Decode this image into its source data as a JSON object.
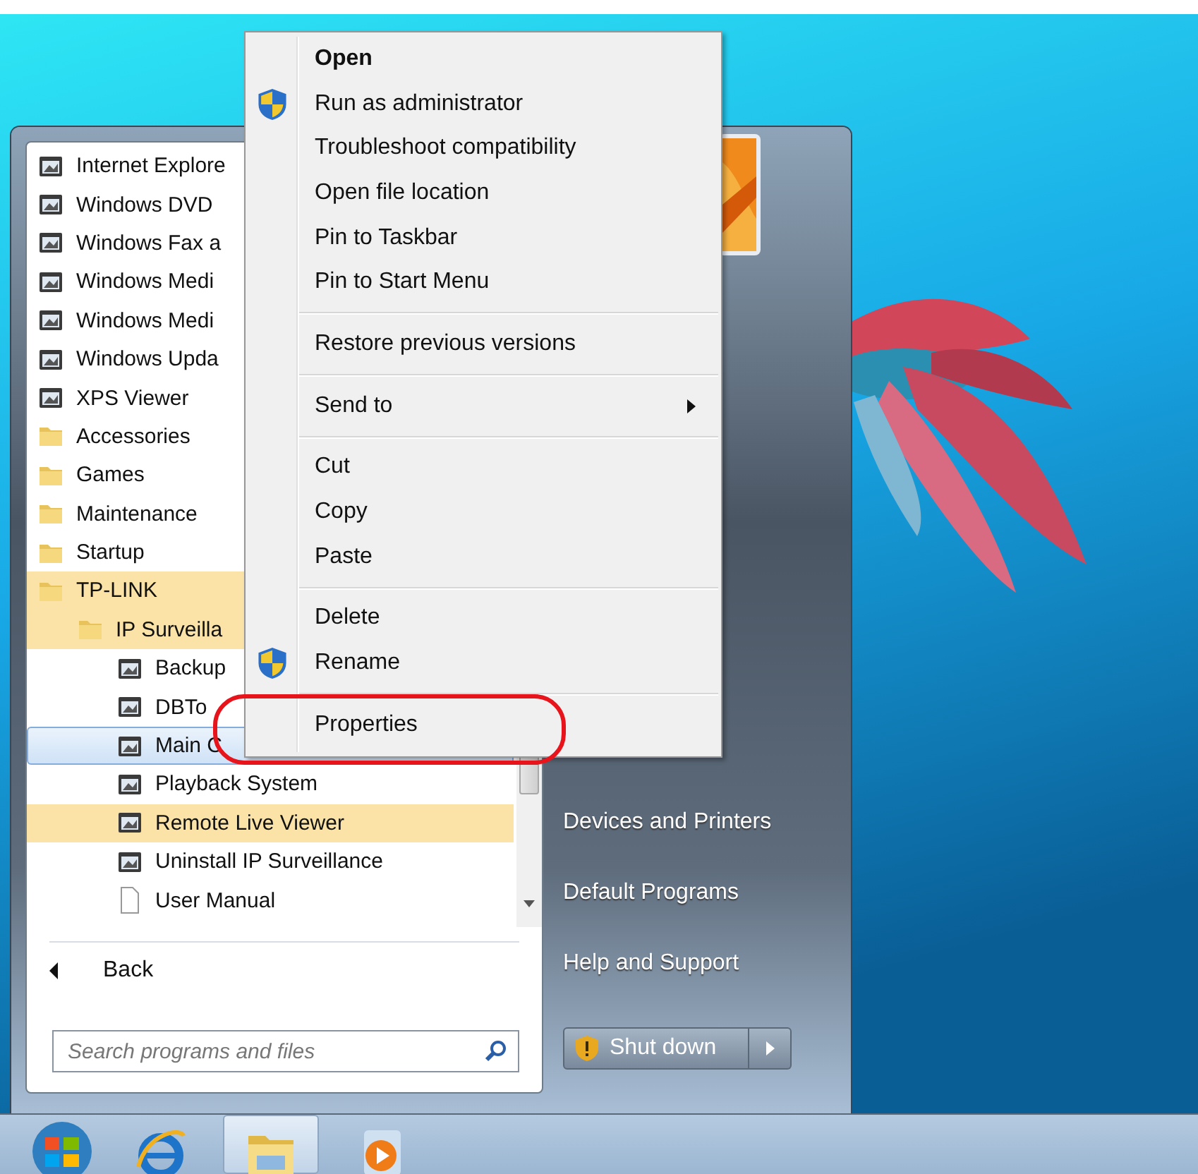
{
  "start_menu": {
    "programs": [
      {
        "label": "Internet Explore",
        "kind": "program",
        "selected": false,
        "new": false
      },
      {
        "label": "Windows DVD",
        "kind": "program",
        "selected": false,
        "new": false
      },
      {
        "label": "Windows Fax a",
        "kind": "program",
        "selected": false,
        "new": false
      },
      {
        "label": "Windows Medi",
        "kind": "program",
        "selected": false,
        "new": false
      },
      {
        "label": "Windows Medi",
        "kind": "program",
        "selected": false,
        "new": false
      },
      {
        "label": "Windows Upda",
        "kind": "program",
        "selected": false,
        "new": false
      },
      {
        "label": "XPS Viewer",
        "kind": "program",
        "selected": false,
        "new": false
      },
      {
        "label": "Accessories",
        "kind": "folder",
        "selected": false,
        "new": false
      },
      {
        "label": "Games",
        "kind": "folder",
        "selected": false,
        "new": false
      },
      {
        "label": "Maintenance",
        "kind": "folder",
        "selected": false,
        "new": false
      },
      {
        "label": "Startup",
        "kind": "folder",
        "selected": false,
        "new": false
      },
      {
        "label": "TP-LINK",
        "kind": "folder",
        "selected": false,
        "new": true,
        "children": [
          {
            "label": "IP Surveilla",
            "kind": "folder",
            "selected": false,
            "new": true,
            "children": [
              {
                "label": "Backup",
                "kind": "program",
                "selected": false,
                "new": false
              },
              {
                "label": "DBTo",
                "kind": "program",
                "selected": false,
                "new": false
              },
              {
                "label": "Main C",
                "kind": "program",
                "selected": true,
                "new": false
              },
              {
                "label": "Playback System",
                "kind": "program",
                "selected": false,
                "new": false
              },
              {
                "label": "Remote Live Viewer",
                "kind": "program",
                "selected": false,
                "new": true
              },
              {
                "label": "Uninstall IP Surveillance",
                "kind": "program",
                "selected": false,
                "new": false
              },
              {
                "label": "User Manual",
                "kind": "document",
                "selected": false,
                "new": false
              }
            ]
          }
        ]
      }
    ],
    "back": "Back",
    "search": {
      "placeholder": "Search programs and files"
    },
    "links": [
      "Devices and Printers",
      "Default Programs",
      "Help and Support"
    ],
    "shutdown": "Shut down"
  },
  "context_menu": {
    "groups": [
      {
        "items": [
          {
            "label": "Open",
            "default": true,
            "shield": false,
            "submenu": false,
            "circled": false
          },
          {
            "label": "Run as administrator",
            "default": false,
            "shield": true,
            "submenu": false,
            "circled": false
          },
          {
            "label": "Troubleshoot compatibility",
            "default": false,
            "shield": false,
            "submenu": false,
            "circled": false
          },
          {
            "label": "Open file location",
            "default": false,
            "shield": false,
            "submenu": false,
            "circled": false
          },
          {
            "label": "Pin to Taskbar",
            "default": false,
            "shield": false,
            "submenu": false,
            "circled": false
          },
          {
            "label": "Pin to Start Menu",
            "default": false,
            "shield": false,
            "submenu": false,
            "circled": false
          }
        ]
      },
      {
        "items": [
          {
            "label": "Restore previous versions",
            "default": false,
            "shield": false,
            "submenu": false,
            "circled": false
          }
        ]
      },
      {
        "items": [
          {
            "label": "Send to",
            "default": false,
            "shield": false,
            "submenu": true,
            "circled": false
          }
        ]
      },
      {
        "items": [
          {
            "label": "Cut",
            "default": false,
            "shield": false,
            "submenu": false,
            "circled": false
          },
          {
            "label": "Copy",
            "default": false,
            "shield": false,
            "submenu": false,
            "circled": false
          },
          {
            "label": "Paste",
            "default": false,
            "shield": false,
            "submenu": false,
            "circled": false
          }
        ]
      },
      {
        "items": [
          {
            "label": "Delete",
            "default": false,
            "shield": false,
            "submenu": false,
            "circled": false
          },
          {
            "label": "Rename",
            "default": false,
            "shield": true,
            "submenu": false,
            "circled": false
          }
        ]
      },
      {
        "items": [
          {
            "label": "Properties",
            "default": false,
            "shield": false,
            "submenu": false,
            "circled": true
          }
        ]
      }
    ]
  },
  "taskbar": [
    {
      "kind": "start",
      "selected": false
    },
    {
      "kind": "browser",
      "selected": false
    },
    {
      "kind": "folder",
      "selected": true
    },
    {
      "kind": "player",
      "selected": false
    }
  ]
}
